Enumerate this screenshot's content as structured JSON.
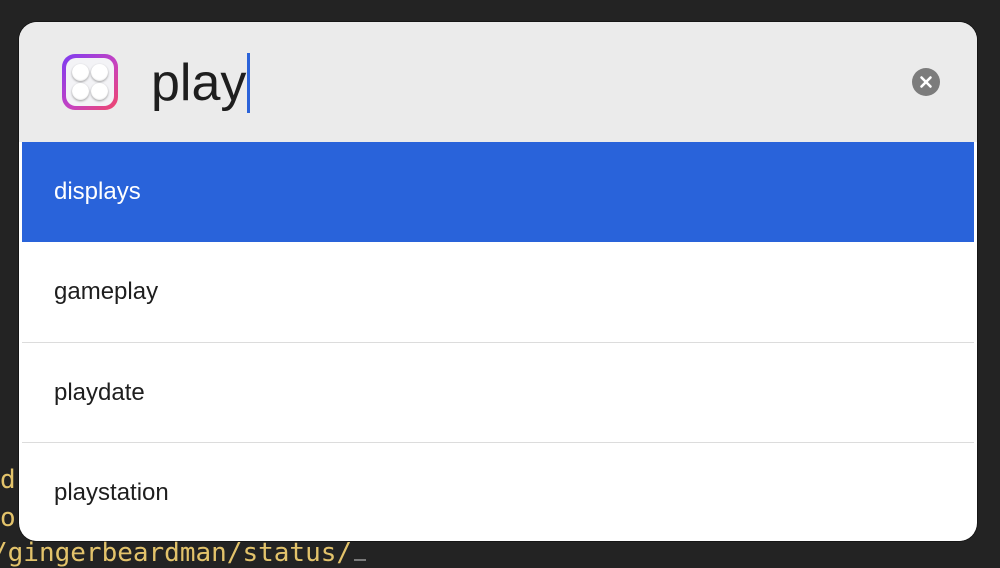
{
  "terminal": {
    "lines": [
      "d",
      "o",
      "/gingerbeardman/status/"
    ]
  },
  "launcher": {
    "app_icon": "app-grid-icon",
    "search": {
      "value": "play",
      "placeholder": ""
    },
    "clear_icon": "close-circle-icon",
    "results": [
      {
        "label": "displays",
        "selected": true
      },
      {
        "label": "gameplay",
        "selected": false
      },
      {
        "label": "playdate",
        "selected": false
      },
      {
        "label": "playstation",
        "selected": false
      }
    ]
  },
  "colors": {
    "selection": "#2963da",
    "terminal_text": "#e3c36b",
    "caret": "#2b63d9"
  }
}
